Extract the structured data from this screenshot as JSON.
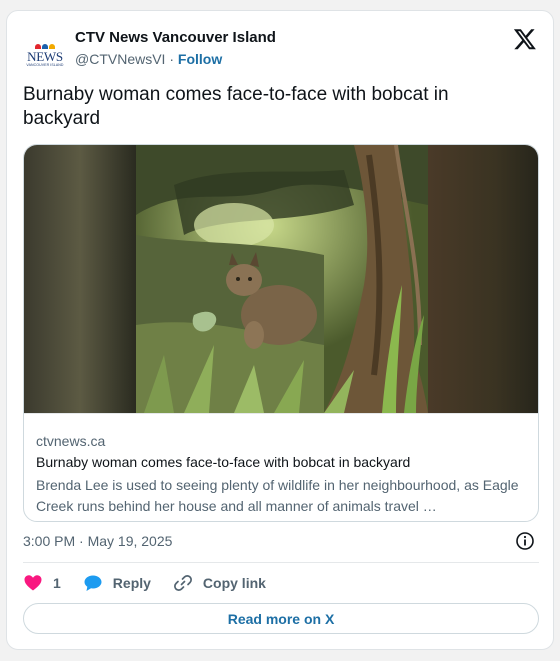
{
  "account": {
    "display_name": "CTV News Vancouver Island",
    "handle": "@CTVNewsVI",
    "separator": "·",
    "follow_label": "Follow",
    "logo_text": "NEWS",
    "logo_subtext": "VANCOUVER ISLAND",
    "logo_icon": "ctv-news-logo"
  },
  "tweet": {
    "text": "Burnaby woman comes face-to-face with bobcat in backyard",
    "timestamp": "3:00 PM · May 19, 2025"
  },
  "link_card": {
    "image_icon": "bobcat-photo",
    "domain": "ctvnews.ca",
    "title": "Burnaby woman comes face-to-face with bobcat in backyard",
    "description": "Brenda Lee is used to seeing plenty of wildlife in her neighbourhood, as Eagle Creek runs behind her house and all manner of animals travel …"
  },
  "actions": {
    "like_count": "1",
    "reply_label": "Reply",
    "copy_link_label": "Copy link"
  },
  "footer": {
    "read_more_label": "Read more on X"
  },
  "colors": {
    "accent": "#1d6fa5",
    "like": "#f91880",
    "secondary_text": "#536471",
    "reply_bubble": "#1d9bf0"
  }
}
